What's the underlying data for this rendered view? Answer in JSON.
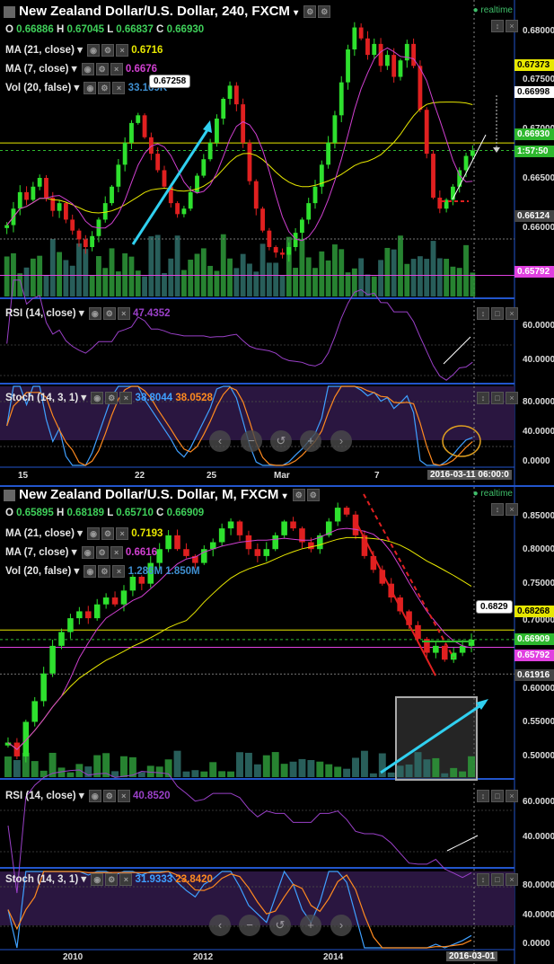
{
  "charts": [
    {
      "title": "New Zealand Dollar/U.S. Dollar, 240, FXCM",
      "realtime_label": "realtime",
      "ohlc": {
        "o_label": "O",
        "o": "0.66886",
        "h_label": "H",
        "h": "0.67045",
        "l_label": "L",
        "l": "0.66837",
        "c_label": "C",
        "c": "0.66930"
      },
      "ma21": {
        "label": "MA (21, close)",
        "value": "0.6716",
        "color": "#e8e800"
      },
      "ma7": {
        "label": "MA (7, close)",
        "value": "0.6676",
        "color": "#d040d0"
      },
      "vol": {
        "label": "Vol (20, false)",
        "value": "33.169K"
      },
      "rsi": {
        "label": "RSI (14, close)",
        "value": "47.4352",
        "color": "#9a40c8",
        "ticks": [
          "60.0000",
          "40.0000"
        ]
      },
      "stoch": {
        "label": "Stoch (14, 3, 1)",
        "k": "38.8044",
        "d": "38.0528",
        "k_color": "#3fa0ff",
        "d_color": "#ff8a1f",
        "ticks": [
          "80.0000",
          "40.0000",
          "0.0000"
        ]
      },
      "price_ticks": [
        "0.68000",
        "0.67500",
        "0.67000",
        "0.66500",
        "0.66000"
      ],
      "tags": [
        {
          "text": "0.67373",
          "bg": "#e8e800",
          "fg": "#000"
        },
        {
          "text": "0.66998",
          "bg": "#fff",
          "fg": "#000"
        },
        {
          "text": "0.66930",
          "bg": "#2eb82e",
          "fg": "#fff"
        },
        {
          "text": "1:57:50",
          "bg": "#2eb82e",
          "fg": "#fff"
        },
        {
          "text": "0.66124",
          "bg": "#444",
          "fg": "#fff"
        },
        {
          "text": "0.65792",
          "bg": "#e040e0",
          "fg": "#fff"
        }
      ],
      "callout": "0.67258",
      "x_labels": [
        "15",
        "22",
        "25",
        "Mar",
        "7"
      ],
      "x_cursor": "2016-03-11 06:00:0",
      "chart_data": {
        "type": "candlestick",
        "title": "New Zealand Dollar/U.S. Dollar, 240, FXCM",
        "ylim": [
          0.656,
          0.683
        ],
        "close": [
          0.6625,
          0.664,
          0.6655,
          0.6648,
          0.666,
          0.6668,
          0.665,
          0.6638,
          0.6645,
          0.663,
          0.662,
          0.6612,
          0.6605,
          0.6615,
          0.663,
          0.6645,
          0.666,
          0.668,
          0.67,
          0.6718,
          0.6725,
          0.6705,
          0.669,
          0.6675,
          0.666,
          0.6645,
          0.6635,
          0.664,
          0.6655,
          0.667,
          0.6685,
          0.67,
          0.6722,
          0.674,
          0.6752,
          0.6735,
          0.67,
          0.6665,
          0.664,
          0.662,
          0.6605,
          0.66,
          0.6598,
          0.6605,
          0.6618,
          0.663,
          0.6645,
          0.666,
          0.668,
          0.67,
          0.6725,
          0.6755,
          0.6785,
          0.6805,
          0.6795,
          0.678,
          0.679,
          0.677,
          0.678,
          0.676,
          0.6775,
          0.679,
          0.677,
          0.673,
          0.669,
          0.665,
          0.664,
          0.6648,
          0.666,
          0.6675,
          0.6688,
          0.6693
        ],
        "levels": {
          "ma21": 0.6716,
          "ma7": 0.6676,
          "ref_high": 0.66998,
          "last": 0.6693,
          "ref_low": 0.66124,
          "support": 0.65792,
          "ma_tag": 0.67373
        }
      }
    },
    {
      "title": "New Zealand Dollar/U.S. Dollar, M, FXCM",
      "realtime_label": "realtime",
      "ohlc": {
        "o_label": "O",
        "o": "0.65895",
        "h_label": "H",
        "h": "0.68189",
        "l_label": "L",
        "l": "0.65710",
        "c_label": "C",
        "c": "0.66909"
      },
      "ma21": {
        "label": "MA (21, close)",
        "value": "0.7193",
        "color": "#e8e800"
      },
      "ma7": {
        "label": "MA (7, close)",
        "value": "0.6616",
        "color": "#d040d0"
      },
      "vol": {
        "label": "Vol (20, false)",
        "value": "1.286M",
        "value2": "1.850M"
      },
      "rsi": {
        "label": "RSI (14, close)",
        "value": "40.8520",
        "color": "#9a40c8",
        "ticks": [
          "60.0000",
          "40.0000"
        ]
      },
      "stoch": {
        "label": "Stoch (14, 3, 1)",
        "k": "31.9333",
        "d": "23.8420",
        "k_color": "#3fa0ff",
        "d_color": "#ff8a1f",
        "ticks": [
          "80.0000",
          "40.0000",
          "0.0000"
        ]
      },
      "price_ticks": [
        "0.85000",
        "0.80000",
        "0.75000",
        "0.70000",
        "0.60000",
        "0.55000",
        "0.50000"
      ],
      "tags": [
        {
          "text": "0.68268",
          "bg": "#e8e800",
          "fg": "#000"
        },
        {
          "text": "0.66909",
          "bg": "#2eb82e",
          "fg": "#fff"
        },
        {
          "text": "0.65792",
          "bg": "#e040e0",
          "fg": "#fff"
        },
        {
          "text": "0.61916",
          "bg": "#444",
          "fg": "#fff"
        }
      ],
      "callout": "0.6829",
      "x_labels": [
        "2010",
        "2012",
        "2014"
      ],
      "x_cursor": "2016-03-01",
      "chart_data": {
        "type": "candlestick",
        "title": "New Zealand Dollar/U.S. Dollar, M, FXCM",
        "ylim": [
          0.47,
          0.89
        ],
        "close": [
          0.52,
          0.5,
          0.55,
          0.58,
          0.62,
          0.66,
          0.68,
          0.7,
          0.71,
          0.7,
          0.72,
          0.73,
          0.72,
          0.74,
          0.76,
          0.75,
          0.78,
          0.8,
          0.82,
          0.8,
          0.79,
          0.78,
          0.8,
          0.81,
          0.83,
          0.84,
          0.82,
          0.8,
          0.79,
          0.8,
          0.82,
          0.84,
          0.83,
          0.81,
          0.8,
          0.82,
          0.84,
          0.86,
          0.85,
          0.82,
          0.79,
          0.77,
          0.75,
          0.73,
          0.71,
          0.69,
          0.67,
          0.65,
          0.66,
          0.64,
          0.65,
          0.66,
          0.669
        ],
        "levels": {
          "ma21": 0.7193,
          "ma7": 0.6616,
          "ref_high": 0.6829,
          "last": 0.66909,
          "support": 0.65792,
          "low": 0.61916,
          "ma_tag": 0.68268
        }
      }
    }
  ]
}
